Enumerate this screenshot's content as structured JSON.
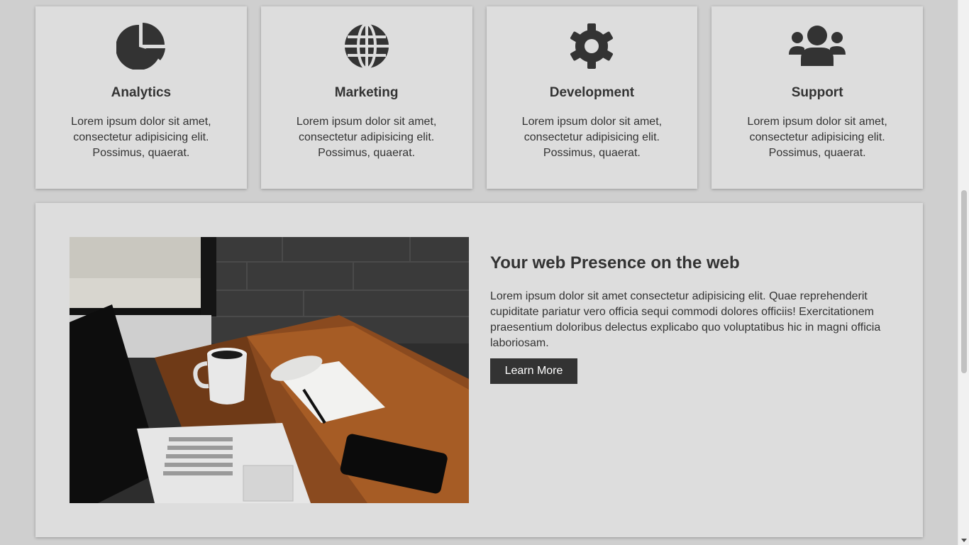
{
  "features": [
    {
      "icon": "pie-chart-icon",
      "title": "Analytics",
      "text": "Lorem ipsum dolor sit amet, consectetur adipisicing elit. Possimus, quaerat."
    },
    {
      "icon": "globe-icon",
      "title": "Marketing",
      "text": "Lorem ipsum dolor sit amet, consectetur adipisicing elit. Possimus, quaerat."
    },
    {
      "icon": "gear-icon",
      "title": "Development",
      "text": "Lorem ipsum dolor sit amet, consectetur adipisicing elit. Possimus, quaerat."
    },
    {
      "icon": "users-icon",
      "title": "Support",
      "text": "Lorem ipsum dolor sit amet, consectetur adipisicing elit. Possimus, quaerat."
    }
  ],
  "showcase": {
    "image": "workspace-photo",
    "heading": "Your web Presence on the web",
    "body": "Lorem ipsum dolor sit amet consectetur adipisicing elit. Quae reprehenderit cupiditate pariatur vero officia sequi commodi dolores officiis! Exercitationem praesentium doloribus delectus explicabo quo voluptatibus hic in magni officia laboriosam.",
    "button_label": "Learn More"
  },
  "colors": {
    "page_background": "#cfcfcf",
    "card_background": "#dddddd",
    "text": "#333333",
    "button_background": "#333333",
    "button_text": "#ffffff"
  }
}
